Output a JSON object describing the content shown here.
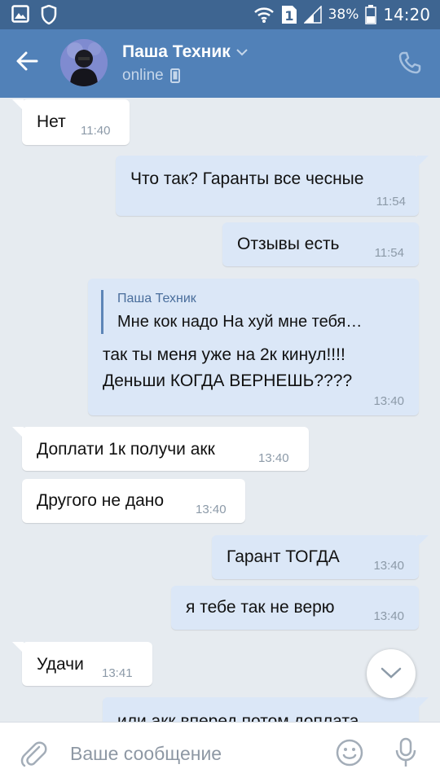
{
  "status_bar": {
    "battery_percent": "38%",
    "time": "14:20",
    "sim_label": "1",
    "icons": [
      "gallery-icon",
      "shield-icon",
      "wifi-icon",
      "sim-icon",
      "signal-icon",
      "battery-icon"
    ]
  },
  "header": {
    "peer_name": "Паша Техник",
    "peer_status": "online"
  },
  "messages": [
    {
      "dir": "in",
      "text": "Нет",
      "time": "11:40"
    },
    {
      "dir": "out",
      "text": "Что так? Гаранты все чесные",
      "time": "11:54"
    },
    {
      "dir": "out",
      "text": "Отзывы есть",
      "time": "11:54"
    },
    {
      "dir": "out",
      "quote_author": "Паша Техник",
      "quote_text": "Мне кок надо На хуй мне тебя…",
      "text_lines": [
        "так ты меня уже на 2к кинул!!!!",
        "Деньши КОГДА ВЕРНЕШЬ????"
      ],
      "time": "13:40"
    },
    {
      "dir": "in",
      "text": "Доплати 1к получи акк",
      "time": "13:40"
    },
    {
      "dir": "in",
      "text": "Другого не дано",
      "time": "13:40"
    },
    {
      "dir": "out",
      "text": "Гарант ТОГДА",
      "time": "13:40"
    },
    {
      "dir": "out",
      "text": "я тебе так не верю",
      "time": "13:40"
    },
    {
      "dir": "in",
      "text": "Удачи",
      "time": "13:41"
    },
    {
      "dir": "out",
      "text": "или акк вперед потом доплата",
      "time": ""
    }
  ],
  "composer": {
    "placeholder": "Ваше сообщение"
  },
  "colors": {
    "status_bar": "#3e6591",
    "header": "#5181b8",
    "chat_background": "#e6ebf0",
    "incoming_bubble": "#ffffff",
    "outgoing_bubble": "#dbe7f7",
    "timestamp": "#8c9aa8",
    "accent": "#5d85b7"
  }
}
